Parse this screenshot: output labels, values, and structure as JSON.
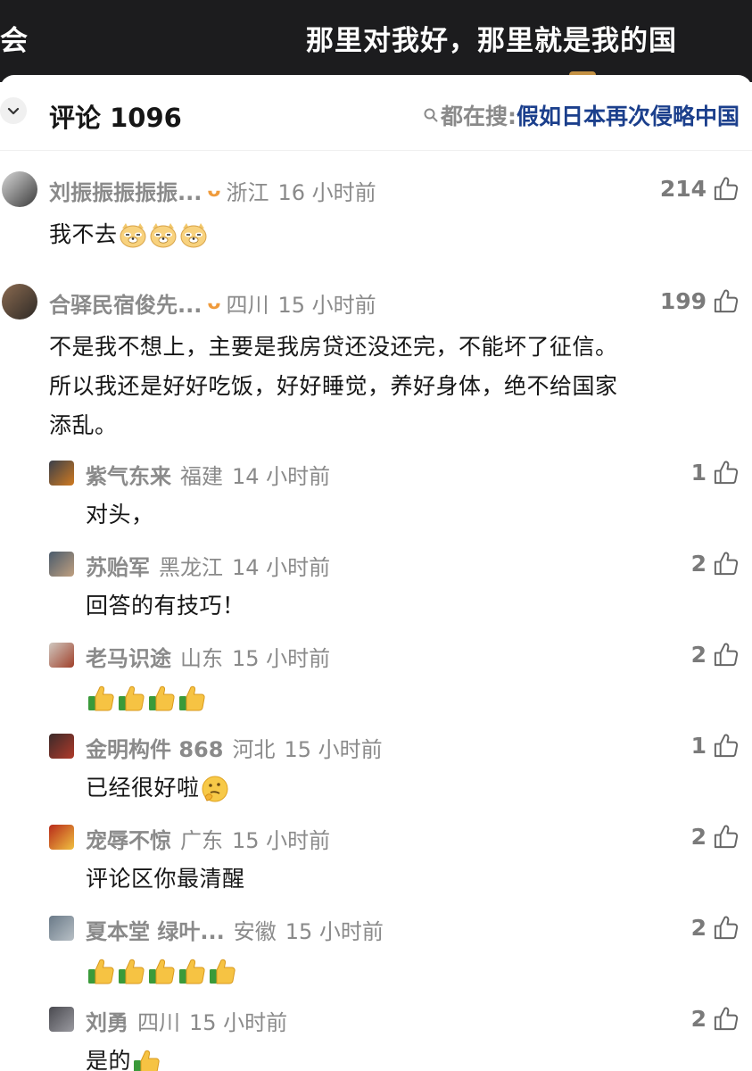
{
  "video": {
    "left_fragment": "会",
    "caption": "那里对我好，那里就是我的国"
  },
  "header": {
    "title": "评论 1096",
    "hot_prefix": "都在搜:",
    "hot_term": "假如日本再次侵略中国",
    "collapse_icon": "chevron-down-icon",
    "search_icon": "search-icon"
  },
  "comments": [
    {
      "author": "刘振振振振振...",
      "badge": "ᴗ",
      "location": "浙江",
      "time": "16 小时前",
      "likes": "214",
      "text": "我不去",
      "emojis": [
        "doge-icon",
        "doge-icon",
        "doge-icon"
      ],
      "replies": []
    },
    {
      "author": "合驿民宿俊先...",
      "badge": "ᴗ",
      "location": "四川",
      "time": "15 小时前",
      "likes": "199",
      "text_lines": [
        "不是我不想上，主要是我房贷还没还完，不能坏了征信。",
        "所以我还是好好吃饭，好好睡觉，养好身体，绝不给国家",
        "添乱。"
      ],
      "replies": [
        {
          "author": "紫气东来",
          "location": "福建",
          "time": "14 小时前",
          "likes": "1",
          "text": "对头，",
          "emojis": []
        },
        {
          "author": "苏贻军",
          "location": "黑龙江",
          "time": "14 小时前",
          "likes": "2",
          "text": "回答的有技巧！",
          "emojis": []
        },
        {
          "author": "老马识途",
          "location": "山东",
          "time": "15 小时前",
          "likes": "2",
          "text": "",
          "emojis": [
            "thumbs-up-icon",
            "thumbs-up-icon",
            "thumbs-up-icon",
            "thumbs-up-icon"
          ]
        },
        {
          "author": "金明构件 868",
          "location": "河北",
          "time": "15 小时前",
          "likes": "1",
          "text": "已经很好啦",
          "emojis": [
            "thinking-face-icon"
          ]
        },
        {
          "author": "宠辱不惊",
          "location": "广东",
          "time": "15 小时前",
          "likes": "2",
          "text": "评论区你最清醒",
          "emojis": []
        },
        {
          "author": "夏本堂 绿叶...",
          "location": "安徽",
          "time": "15 小时前",
          "likes": "2",
          "text": "",
          "emojis": [
            "thumbs-up-icon",
            "thumbs-up-icon",
            "thumbs-up-icon",
            "thumbs-up-icon",
            "thumbs-up-icon"
          ]
        },
        {
          "author": "刘勇",
          "location": "四川",
          "time": "15 小时前",
          "likes": "2",
          "text": "是的",
          "emojis": [
            "thumbs-up-icon"
          ]
        }
      ]
    }
  ],
  "colors": {
    "accent_term": "#1b3f8c",
    "badge": "#ef9b3c",
    "meta_gray": "#8a8a8a"
  }
}
